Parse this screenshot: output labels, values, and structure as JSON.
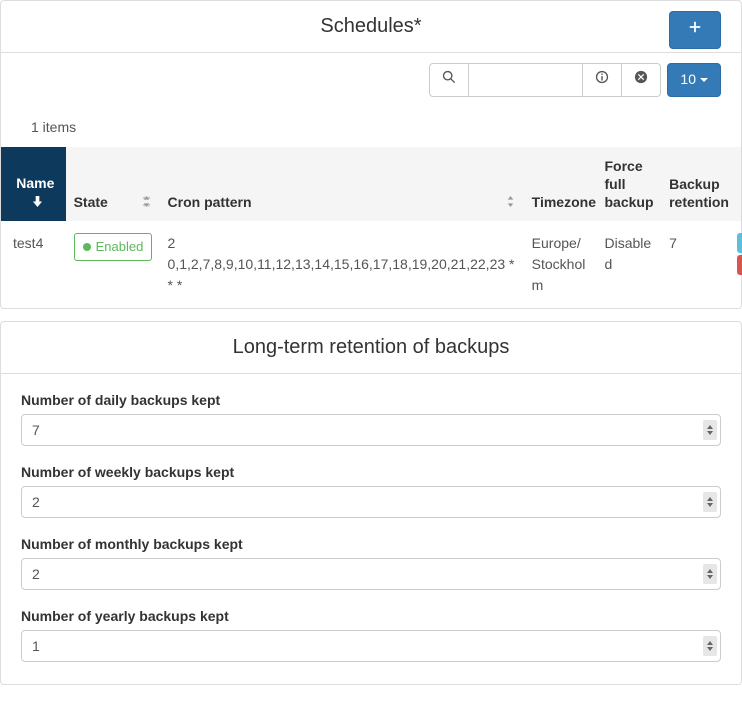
{
  "schedules": {
    "title": "Schedules*",
    "items_count": "1 items",
    "page_size": "10",
    "search_value": "",
    "columns": {
      "name": "Name",
      "state": "State",
      "cron": "Cron pattern",
      "timezone": "Timezone",
      "force": "Force full backup",
      "retention": "Backup retention"
    },
    "rows": [
      {
        "name": "test4",
        "state_label": "Enabled",
        "cron": "2 0,1,2,7,8,9,10,11,12,13,14,15,16,17,18,19,20,21,22,23 * * *",
        "timezone": "Europe/ Stockholm",
        "force": "Disabled",
        "retention": "7"
      }
    ]
  },
  "retention_panel": {
    "title": "Long-term retention of backups",
    "fields": {
      "daily": {
        "label": "Number of daily backups kept",
        "value": "7"
      },
      "weekly": {
        "label": "Number of weekly backups kept",
        "value": "2"
      },
      "monthly": {
        "label": "Number of monthly backups kept",
        "value": "2"
      },
      "yearly": {
        "label": "Number of yearly backups kept",
        "value": "1"
      }
    }
  }
}
